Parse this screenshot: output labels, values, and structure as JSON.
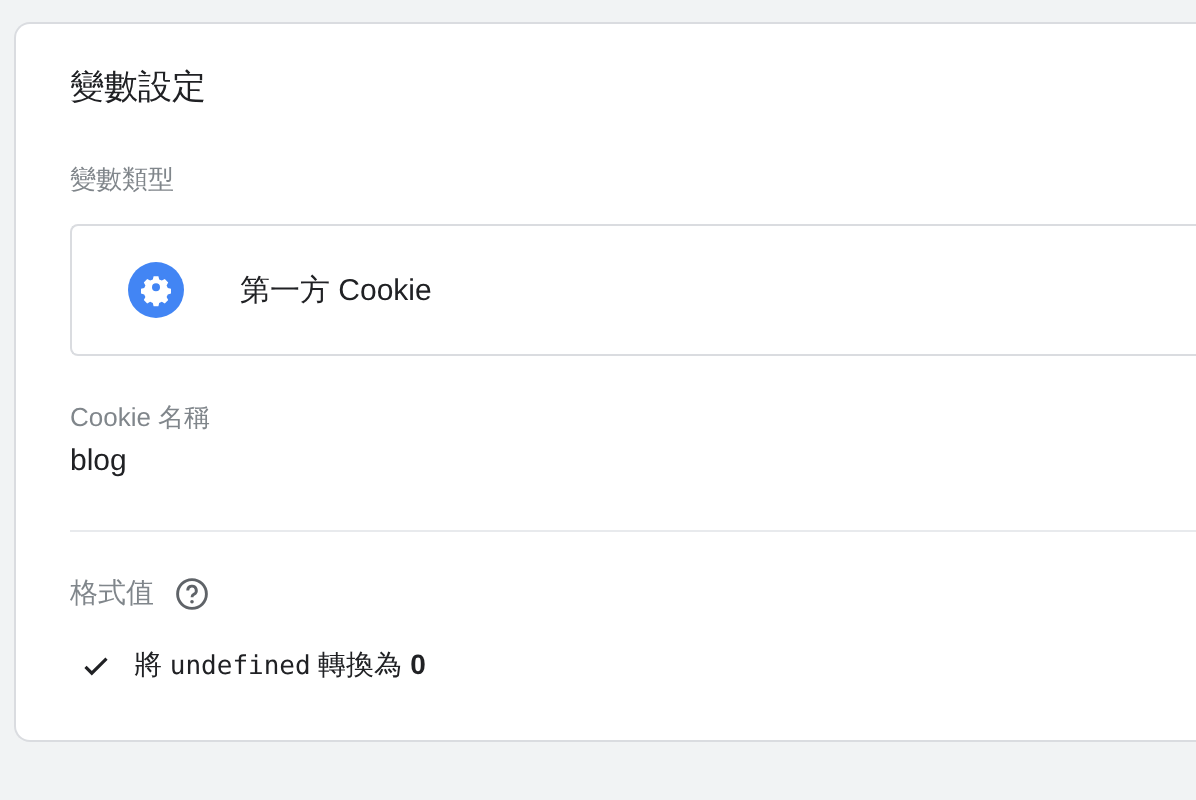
{
  "card": {
    "title": "變數設定"
  },
  "variable_type": {
    "label": "變數類型",
    "value": "第一方 Cookie"
  },
  "cookie_name": {
    "label": "Cookie 名稱",
    "value": "blog"
  },
  "format_value": {
    "label": "格式值",
    "options": [
      {
        "checked": true,
        "parts": [
          {
            "kind": "text",
            "text": "將 "
          },
          {
            "kind": "code",
            "text": "undefined"
          },
          {
            "kind": "text",
            "text": " 轉換為 "
          },
          {
            "kind": "bold",
            "text": "0"
          }
        ]
      }
    ]
  }
}
